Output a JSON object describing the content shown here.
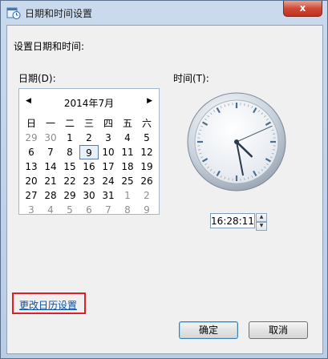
{
  "window": {
    "title": "日期和时间设置",
    "close": "x"
  },
  "labels": {
    "heading": "设置日期和时间:",
    "date": "日期(D):",
    "time": "时间(T):"
  },
  "calendar": {
    "month_title": "2014年7月",
    "prev": "◀",
    "next": "▶",
    "weekdays": [
      "日",
      "一",
      "二",
      "三",
      "四",
      "五",
      "六"
    ],
    "weeks": [
      [
        "29",
        "30",
        "1",
        "2",
        "3",
        "4",
        "5"
      ],
      [
        "6",
        "7",
        "8",
        "9",
        "10",
        "11",
        "12"
      ],
      [
        "13",
        "14",
        "15",
        "16",
        "17",
        "18",
        "19"
      ],
      [
        "20",
        "21",
        "22",
        "23",
        "24",
        "25",
        "26"
      ],
      [
        "27",
        "28",
        "29",
        "30",
        "31",
        "1",
        "2"
      ],
      [
        "3",
        "4",
        "5",
        "6",
        "7",
        "8",
        "9"
      ]
    ],
    "selected": "9"
  },
  "clock": {
    "hour": 16,
    "minute": 28,
    "second": 11
  },
  "time": {
    "value": "16:28:11",
    "up": "▲",
    "down": "▼"
  },
  "link": "更改日历设置",
  "buttons": {
    "ok": "确定",
    "cancel": "取消"
  }
}
